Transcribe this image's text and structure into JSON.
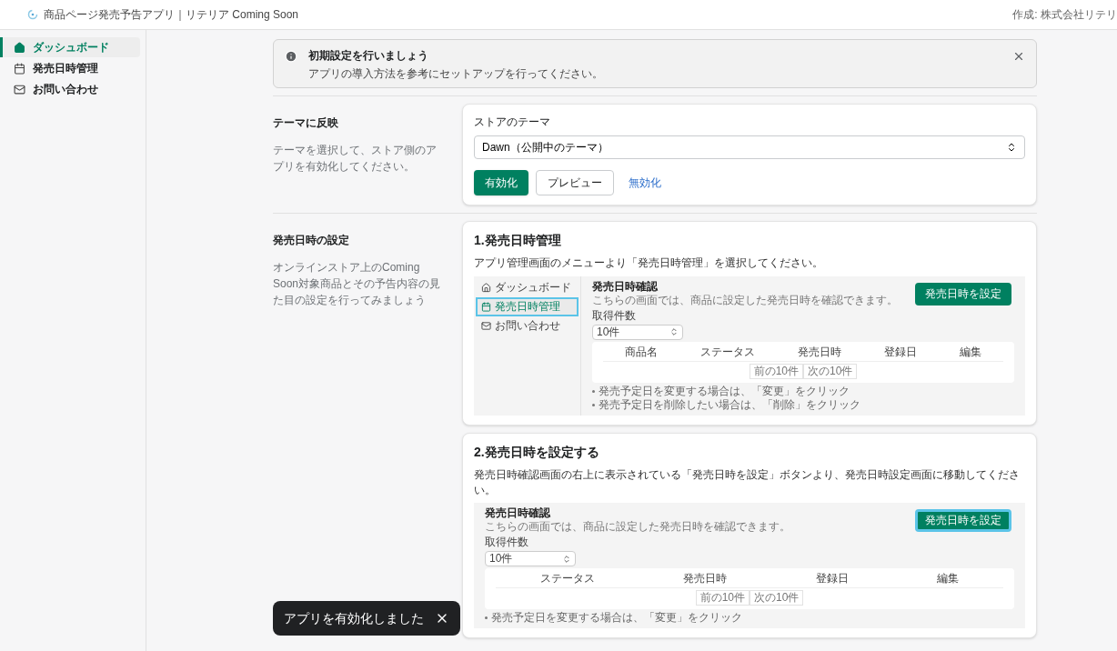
{
  "app_bar": {
    "title": "商品ページ発売予告アプリ｜リテリア Coming Soon",
    "author": "作成: 株式会社リテリ"
  },
  "sidebar": {
    "items": [
      {
        "label": "ダッシュボード",
        "selected": true
      },
      {
        "label": "発売日時管理",
        "selected": false
      },
      {
        "label": "お問い合わせ",
        "selected": false
      }
    ]
  },
  "banner": {
    "title": "初期設定を行いましょう",
    "message": "アプリの導入方法を参考にセットアップを行ってください。"
  },
  "sections": [
    {
      "kind": "theme",
      "title": "テーマに反映",
      "description": "テーマを選択して、ストア側のアプリを有効化してください。",
      "field_label": "ストアのテーマ",
      "select_value": "Dawn（公開中のテーマ）",
      "buttons": [
        {
          "label": "有効化",
          "kind": "primary"
        },
        {
          "label": "プレビュー",
          "kind": "secondary"
        },
        {
          "label": "無効化",
          "kind": "link"
        }
      ]
    },
    {
      "kind": "steps",
      "title": "発売日時の設定",
      "description": "オンラインストア上のComing Soon対象商品とその予告内容の見た目の設定を行ってみましょう",
      "steps": [
        {
          "title": "1.発売日時管理",
          "text": "アプリ管理画面のメニューより「発売日時管理」を選択してください。",
          "screenshot": {
            "sidebar_items": [
              {
                "label": "ダッシュボード",
                "highlighted": false
              },
              {
                "label": "発売日時管理",
                "highlighted": true
              },
              {
                "label": "お問い合わせ",
                "highlighted": false
              }
            ],
            "title": "発売日時確認",
            "subtitle": "こちらの画面では、商品に設定した発売日時を確認できます。",
            "count_label": "取得件数",
            "count_value": "10件",
            "button": {
              "label": "発売日時を設定",
              "highlighted": false
            },
            "columns": [
              "商品名",
              "ステータス",
              "発売日時",
              "登録日",
              "編集"
            ],
            "pagination": [
              "前の10件",
              "次の10件"
            ],
            "notes": [
              "発売予定日を変更する場合は、「変更」をクリック",
              "発売予定日を削除したい場合は、「削除」をクリック"
            ]
          }
        },
        {
          "title": "2.発売日時を設定する",
          "text": "発売日時確認画面の右上に表示されている「発売日時を設定」ボタンより、発売日時設定画面に移動してください。",
          "screenshot": {
            "title": "発売日時確認",
            "subtitle": "こちらの画面では、商品に設定した発売日時を確認できます。",
            "count_label": "取得件数",
            "count_value": "10件",
            "button": {
              "label": "発売日時を設定",
              "highlighted": true
            },
            "columns": [
              "ステータス",
              "発売日時",
              "登録日",
              "編集"
            ],
            "pagination": [
              "前の10件",
              "次の10件"
            ],
            "notes": [
              "発売予定日を変更する場合は、「変更」をクリック"
            ]
          }
        }
      ]
    }
  ],
  "toast": {
    "message": "アプリを有効化しました"
  }
}
